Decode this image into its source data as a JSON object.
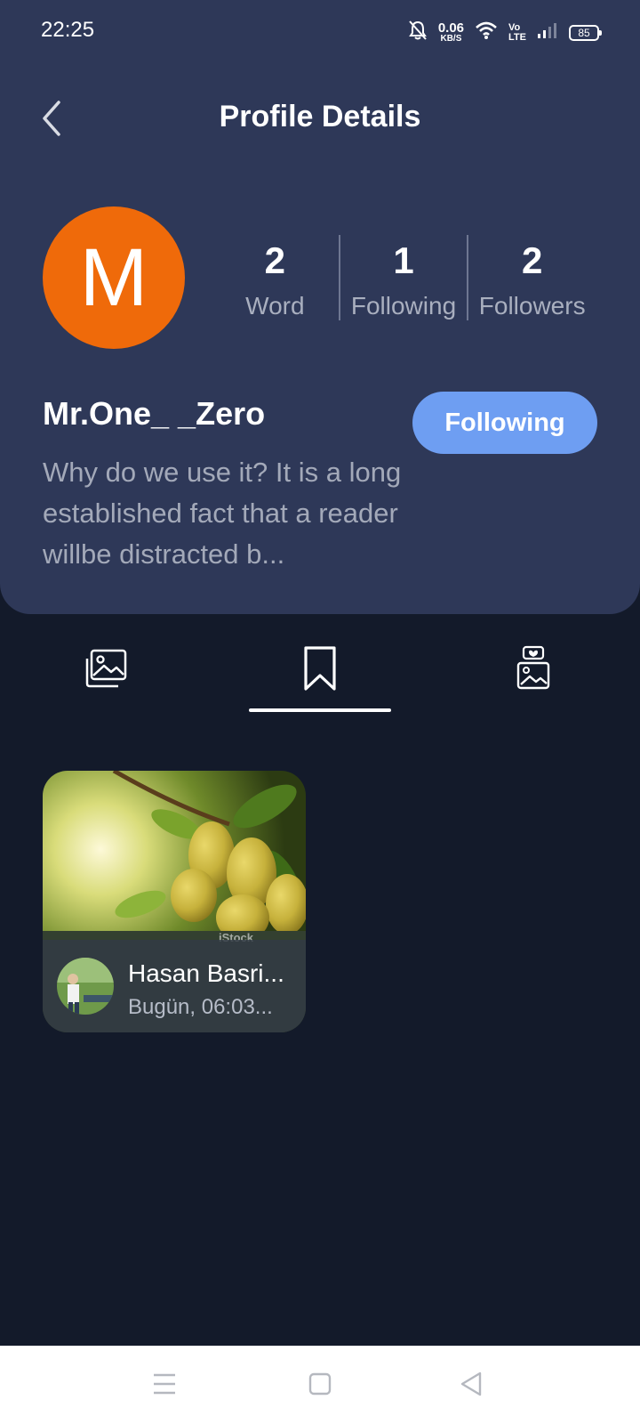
{
  "status_bar": {
    "time": "22:25",
    "net_speed_value": "0.06",
    "net_speed_unit": "KB/S",
    "volte_top": "Vo",
    "volte_bottom": "LTE",
    "battery": "85",
    "icons": [
      "mute-bell-icon",
      "wifi-icon",
      "signal-icon",
      "battery-icon"
    ]
  },
  "header": {
    "title": "Profile Details",
    "back_icon": "chevron-left-icon"
  },
  "profile": {
    "avatar_letter": "M",
    "avatar_color": "#ef6a0a",
    "username": "Mr.One_ _Zero",
    "bio": "Why do we use it? It is a long established fact that a reader willbe distracted b...",
    "follow_button": "Following",
    "stats": [
      {
        "value": "2",
        "label": "Word"
      },
      {
        "value": "1",
        "label": "Following"
      },
      {
        "value": "2",
        "label": "Followers"
      }
    ]
  },
  "tabs": [
    {
      "icon": "images-icon"
    },
    {
      "icon": "bookmark-icon",
      "active": true
    },
    {
      "icon": "liked-images-icon"
    }
  ],
  "posts": [
    {
      "author": "Hasan Basri...",
      "time": "Bugün, 06:03...",
      "watermark": "iStock"
    }
  ],
  "nav_bar": {
    "buttons": [
      "menu-icon",
      "home-square-icon",
      "back-triangle-icon"
    ]
  },
  "colors": {
    "header_bg": "#2e3858",
    "page_bg": "#131a2a",
    "accent": "#6e9ef2"
  }
}
